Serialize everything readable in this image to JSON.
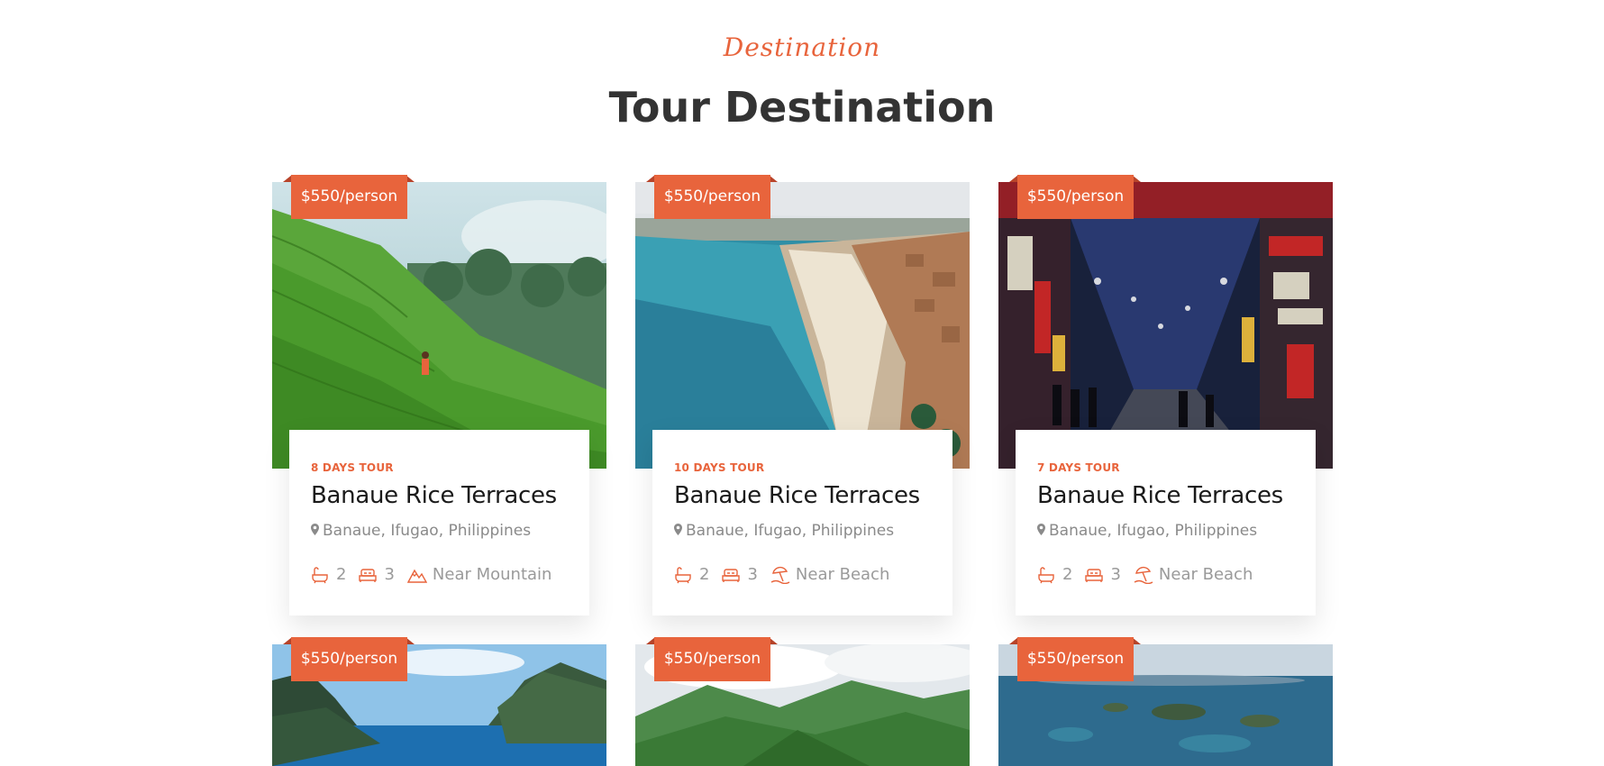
{
  "section": {
    "subtitle": "Destination",
    "title": "Tour Destination"
  },
  "colors": {
    "accent": "#e8643c",
    "heading": "#333333",
    "muted": "#8a8a8a"
  },
  "cards": [
    {
      "price": "$550/person",
      "days": "8 DAYS TOUR",
      "name": "Banaue Rice Terraces",
      "location": "Banaue, Ifugao, Philippines",
      "baths": "2",
      "beds": "3",
      "nearby": "Near Mountain",
      "nearby_icon": "mountain-icon",
      "image": "rice-terraces-photo"
    },
    {
      "price": "$550/person",
      "days": "10 DAYS TOUR",
      "name": "Banaue Rice Terraces",
      "location": "Banaue, Ifugao, Philippines",
      "baths": "2",
      "beds": "3",
      "nearby": "Near Beach",
      "nearby_icon": "beach-icon",
      "image": "coastal-beach-photo"
    },
    {
      "price": "$550/person",
      "days": "7 DAYS TOUR",
      "name": "Banaue Rice Terraces",
      "location": "Banaue, Ifugao, Philippines",
      "baths": "2",
      "beds": "3",
      "nearby": "Near Beach",
      "nearby_icon": "beach-icon",
      "image": "city-street-night-photo"
    },
    {
      "price": "$550/person",
      "image": "lagoon-cliffs-photo"
    },
    {
      "price": "$550/person",
      "image": "green-mountains-photo"
    },
    {
      "price": "$550/person",
      "image": "islands-aerial-photo"
    }
  ]
}
